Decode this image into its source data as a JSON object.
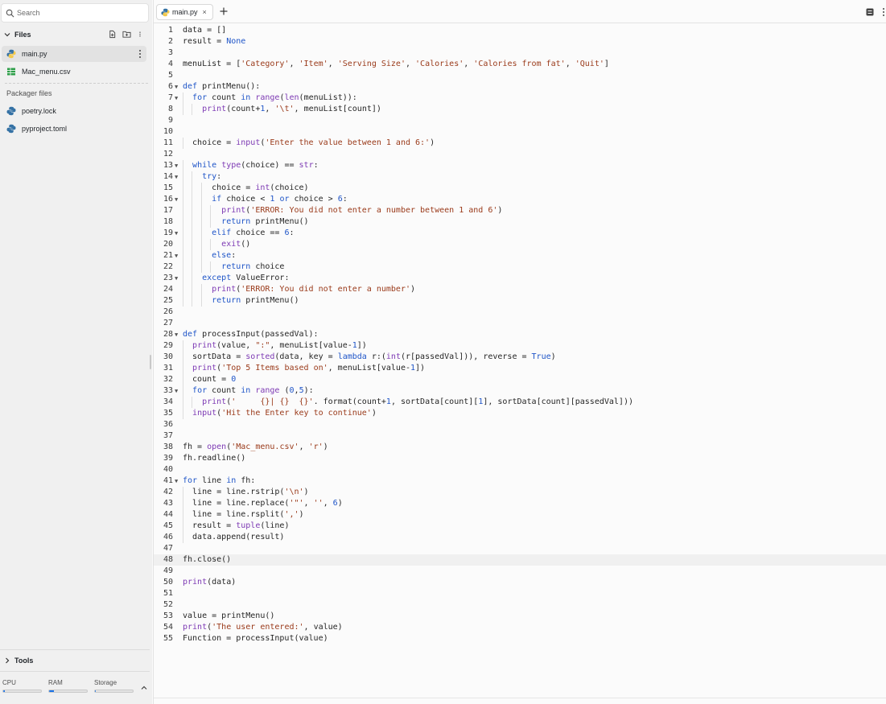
{
  "sidebar": {
    "search": {
      "placeholder": "Search"
    },
    "files_section": {
      "label": "Files"
    },
    "files": [
      {
        "name": "main.py",
        "icon": "python-icon",
        "selected": true
      },
      {
        "name": "Mac_menu.csv",
        "icon": "spreadsheet-icon",
        "selected": false
      }
    ],
    "packager_label": "Packager files",
    "packager_files": [
      {
        "name": "poetry.lock",
        "icon": "python-icon"
      },
      {
        "name": "pyproject.toml",
        "icon": "python-icon"
      }
    ],
    "tools_section": {
      "label": "Tools"
    },
    "meters": [
      {
        "label": "CPU",
        "fraction": 0.04
      },
      {
        "label": "RAM",
        "fraction": 0.12
      },
      {
        "label": "Storage",
        "fraction": 0.03
      }
    ]
  },
  "editor": {
    "tabs": [
      {
        "label": "main.py",
        "close": "×"
      }
    ],
    "new_tab": "+",
    "active_line": 48,
    "lines": [
      "data = []",
      "result = None",
      "",
      "menuList = ['Category', 'Item', 'Serving Size', 'Calories', 'Calories from fat', 'Quit']",
      "",
      "def printMenu():",
      "  for count in range(len(menuList)):",
      "    print(count+1, '\\t', menuList[count])",
      "",
      "",
      "  choice = input('Enter the value between 1 and 6:')",
      "",
      "  while type(choice) == str:",
      "    try:",
      "      choice = int(choice)",
      "      if choice < 1 or choice > 6:",
      "        print('ERROR: You did not enter a number between 1 and 6')",
      "        return printMenu()",
      "      elif choice == 6:",
      "        exit()",
      "      else:",
      "        return choice",
      "    except ValueError:",
      "      print('ERROR: You did not enter a number')",
      "      return printMenu()",
      "",
      "",
      "def processInput(passedVal):",
      "  print(value, \":\", menuList[value-1])",
      "  sortData = sorted(data, key = lambda r:(int(r[passedVal])), reverse = True)",
      "  print('Top 5 Items based on', menuList[value-1])",
      "  count = 0",
      "  for count in range (0,5):",
      "    print('     {}| {}  {}'. format(count+1, sortData[count][1], sortData[count][passedVal]))",
      "  input('Hit the Enter key to continue')",
      "",
      "",
      "fh = open('Mac_menu.csv', 'r')",
      "fh.readline()",
      "",
      "for line in fh:",
      "  line = line.rstrip('\\n')",
      "  line = line.replace('\"', '', 6)",
      "  line = line.rsplit(',')",
      "  result = tuple(line)",
      "  data.append(result)",
      "",
      "fh.close()",
      "",
      "print(data)",
      "",
      "",
      "value = printMenu()",
      "print('The user entered:', value)",
      "Function = processInput(value)"
    ],
    "fold_lines": [
      6,
      7,
      13,
      14,
      16,
      19,
      21,
      23,
      28,
      33,
      41
    ]
  },
  "colors": {
    "keyword": "#1f55c8",
    "builtin": "#7d3ab4",
    "string": "#9a3a1a",
    "python_blue": "#3572a5",
    "python_yellow": "#f2c94c",
    "csv_green": "#2e9e49",
    "meter_fill": "#1a73e8"
  }
}
